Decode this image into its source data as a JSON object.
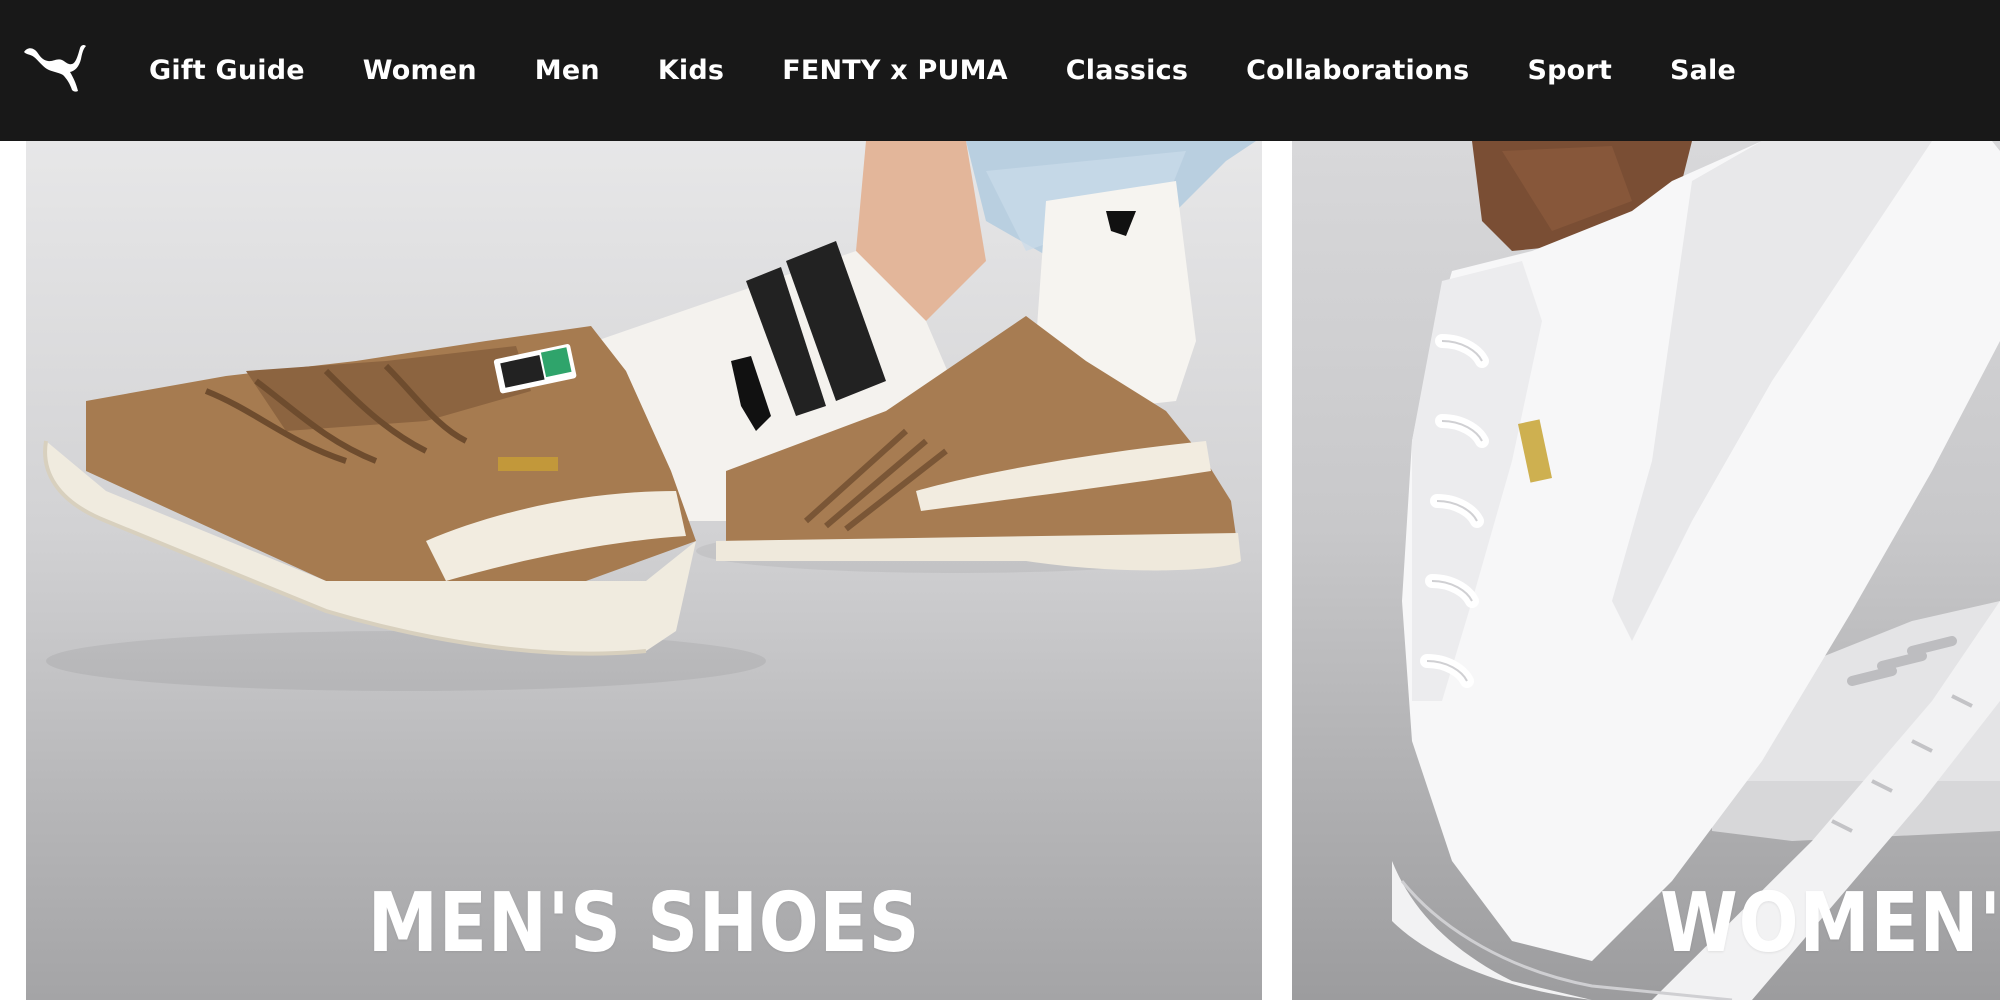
{
  "brand": {
    "logo_icon": "puma-cat-icon",
    "logo_color": "#ffffff"
  },
  "nav": {
    "background": "#181818",
    "items": [
      {
        "label": "Gift Guide"
      },
      {
        "label": "Women"
      },
      {
        "label": "Men"
      },
      {
        "label": "Kids"
      },
      {
        "label": "FENTY x PUMA"
      },
      {
        "label": "Classics"
      },
      {
        "label": "Collaborations"
      },
      {
        "label": "Sport"
      },
      {
        "label": "Sale"
      }
    ]
  },
  "tiles": [
    {
      "title": "MEN'S SHOES",
      "image_icon": "suede-sneakers-photo"
    },
    {
      "title": "WOMEN'S SHOES",
      "image_icon": "white-platform-sneaker-photo"
    }
  ]
}
